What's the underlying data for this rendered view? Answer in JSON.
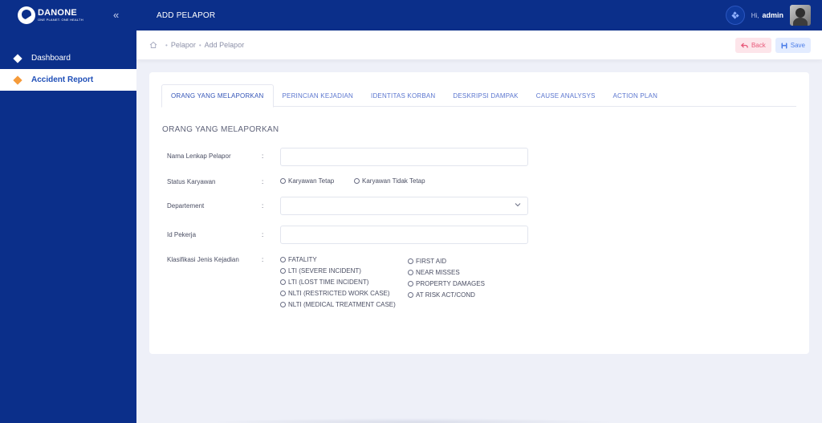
{
  "brand": {
    "name": "DANONE",
    "tagline": "ONE PLANET. ONE HEALTH"
  },
  "sidebar": {
    "items": [
      {
        "label": "Dashboard",
        "active": false
      },
      {
        "label": "Accident Report",
        "active": true
      }
    ]
  },
  "topbar": {
    "title": "ADD PELAPOR",
    "greeting": "Hi,",
    "username": "admin"
  },
  "breadcrumb": {
    "items": [
      "Pelapor",
      "Add Pelapor"
    ]
  },
  "actions": {
    "back_label": "Back",
    "save_label": "Save"
  },
  "tabs": [
    {
      "label": "ORANG YANG MELAPORKAN",
      "active": true
    },
    {
      "label": "PERINCIAN KEJADIAN",
      "active": false
    },
    {
      "label": "IDENTITAS KORBAN",
      "active": false
    },
    {
      "label": "DESKRIPSI DAMPAK",
      "active": false
    },
    {
      "label": "CAUSE ANALYSYS",
      "active": false
    },
    {
      "label": "ACTION PLAN",
      "active": false
    }
  ],
  "form": {
    "section_title": "ORANG YANG MELAPORKAN",
    "colon": ":",
    "nama_label": "Nama Lenkap Pelapor",
    "nama_value": "",
    "status_label": "Status Karyawan",
    "status_options": [
      "Karyawan Tetap",
      "Karyawan Tidak Tetap"
    ],
    "departement_label": "Departement",
    "departement_value": "",
    "id_label": "Id Pekerja",
    "id_value": "",
    "klasifikasi_label": "Klasifikasi Jenis Kejadian",
    "klasifikasi_left": [
      "FATALITY",
      "LTI (SEVERE INCIDENT)",
      "LTI (LOST TIME INCIDENT)",
      "NLTI (RESTRICTED WORK CASE)",
      "NLTI (MEDICAL TREATMENT CASE)"
    ],
    "klasifikasi_right": [
      "FIRST AID",
      "NEAR MISSES",
      "PROPERTY DAMAGES",
      "AT RISK ACT/COND"
    ]
  },
  "colors": {
    "primary": "#0b2f8a",
    "accent": "#f59b3a",
    "back_bg": "#fde5ea",
    "save_bg": "#e3ecff"
  }
}
